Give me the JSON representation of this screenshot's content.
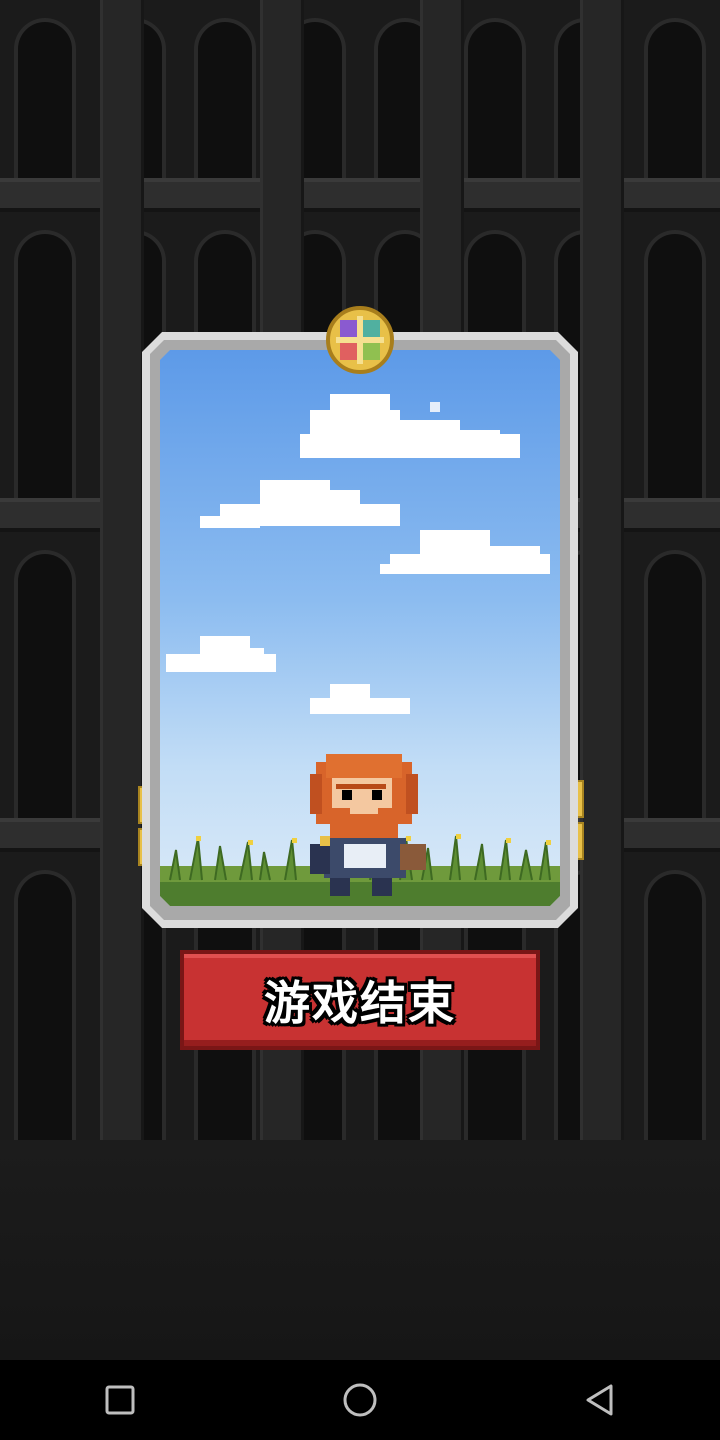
{
  "screen": {
    "button_label": "游戏结束"
  },
  "icons": {
    "emblem": "gold-four-quadrant-emblem",
    "nav_recent": "square-icon",
    "nav_home": "circle-icon",
    "nav_back": "triangle-back-icon"
  },
  "colors": {
    "button": "#c83232",
    "card_frame": "#dcdcdc",
    "sky": "#5d9ae8",
    "background": "#1e1e1e"
  }
}
